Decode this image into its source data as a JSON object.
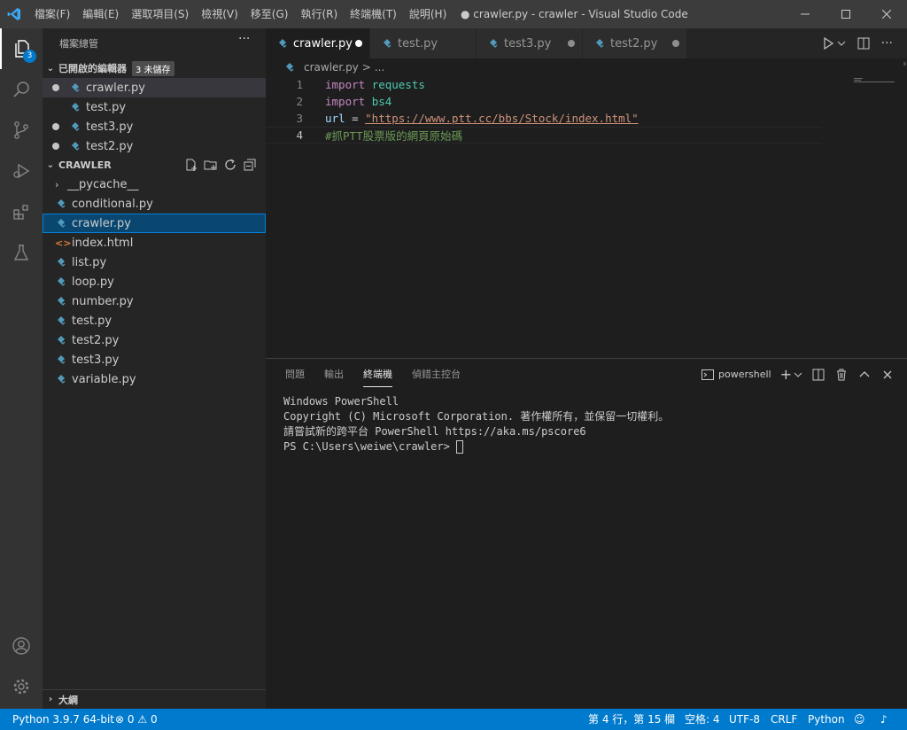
{
  "titlebar": {
    "menu": [
      "檔案(F)",
      "編輯(E)",
      "選取項目(S)",
      "檢視(V)",
      "移至(G)",
      "執行(R)",
      "終端機(T)",
      "說明(H)"
    ],
    "window_title": "● crawler.py - crawler - Visual Studio Code"
  },
  "activity": {
    "explorer_badge": "3"
  },
  "sidebar": {
    "title": "檔案總管",
    "more": "···",
    "open_editors": {
      "label": "已開啟的編輯器",
      "badge": "3 未儲存",
      "files": [
        {
          "name": "crawler.py",
          "dirty": true
        },
        {
          "name": "test.py",
          "dirty": false
        },
        {
          "name": "test3.py",
          "dirty": true
        },
        {
          "name": "test2.py",
          "dirty": true
        }
      ]
    },
    "folder": {
      "label": "CRAWLER",
      "items": [
        {
          "name": "__pycache__",
          "kind": "folder"
        },
        {
          "name": "conditional.py",
          "kind": "py"
        },
        {
          "name": "crawler.py",
          "kind": "py"
        },
        {
          "name": "index.html",
          "kind": "html"
        },
        {
          "name": "list.py",
          "kind": "py"
        },
        {
          "name": "loop.py",
          "kind": "py"
        },
        {
          "name": "number.py",
          "kind": "py"
        },
        {
          "name": "test.py",
          "kind": "py"
        },
        {
          "name": "test2.py",
          "kind": "py"
        },
        {
          "name": "test3.py",
          "kind": "py"
        },
        {
          "name": "variable.py",
          "kind": "py"
        }
      ]
    },
    "outline": "大綱"
  },
  "editor": {
    "tabs": [
      {
        "name": "crawler.py",
        "active": true,
        "dirty": true
      },
      {
        "name": "test.py",
        "active": false,
        "dirty": false
      },
      {
        "name": "test3.py",
        "active": false,
        "dirty": true
      },
      {
        "name": "test2.py",
        "active": false,
        "dirty": true
      }
    ],
    "breadcrumb": {
      "file": "crawler.py",
      "sep": ">",
      "rest": "..."
    },
    "line_numbers": [
      "1",
      "2",
      "3",
      "4"
    ],
    "code": {
      "l1_kw": "import",
      "l1_mod": "requests",
      "l2_kw": "import",
      "l2_mod": "bs4",
      "l3_var": "url",
      "l3_op": " = ",
      "l3_str": "\"https://www.ptt.cc/bbs/Stock/index.html\"",
      "l4_cmt": "#抓PTT股票版的網頁原始碼"
    }
  },
  "panel": {
    "tabs": [
      "問題",
      "輸出",
      "終端機",
      "偵錯主控台"
    ],
    "active_tab": "終端機",
    "shell": "powershell",
    "terminal_lines": [
      "Windows PowerShell",
      "Copyright (C) Microsoft Corporation. 著作權所有，並保留一切權利。",
      "",
      "請嘗試新的跨平台 PowerShell https://aka.ms/pscore6",
      "",
      "PS C:\\Users\\weiwe\\crawler> "
    ]
  },
  "statusbar": {
    "python": "Python 3.9.7 64-bit",
    "errors": "0",
    "warnings": "0",
    "position": "第 4 行，第 15 欄",
    "spaces": "空格: 4",
    "encoding": "UTF-8",
    "eol": "CRLF",
    "language": "Python"
  },
  "colors": {
    "accent": "#007acc",
    "titlebar": "#3c3c3c",
    "sidebar": "#252526",
    "editor": "#1e1e1e"
  }
}
